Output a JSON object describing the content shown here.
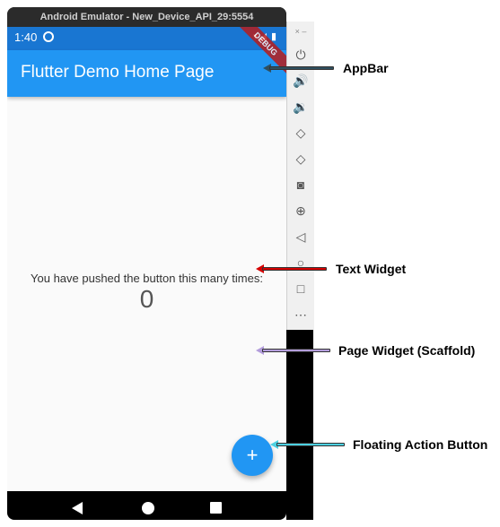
{
  "emulator": {
    "window_title": "Android Emulator - New_Device_API_29:5554",
    "sidebar_top_label": "× –",
    "sidebar_buttons": [
      "power-icon",
      "volume-up-icon",
      "volume-down-icon",
      "rotate-left-icon",
      "rotate-right-icon",
      "camera-icon",
      "zoom-icon",
      "back-icon",
      "home-icon",
      "overview-icon",
      "more-icon"
    ],
    "sidebar_glyphs": [
      "⏻",
      "🔊",
      "🔉",
      "◇",
      "◇",
      "◙",
      "⊕",
      "◁",
      "○",
      "□",
      "⋯"
    ]
  },
  "statusbar": {
    "time": "1:40",
    "icons": "▾◢ ▮"
  },
  "appbar": {
    "title": "Flutter Demo Home Page",
    "debug_banner": "DEBUG"
  },
  "body": {
    "counter_label": "You have pushed the button this many times:",
    "counter_value": "0"
  },
  "fab": {
    "glyph": "+"
  },
  "annotations": {
    "appbar": {
      "label": "AppBar",
      "color": "#2f4f5f"
    },
    "text_widget": {
      "label": "Text Widget",
      "color": "#d50000"
    },
    "page_widget": {
      "label": "Page Widget (Scaffold)",
      "color": "#b39ddb"
    },
    "fab": {
      "label": "Floating Action Button",
      "color": "#4dd0e1"
    }
  }
}
